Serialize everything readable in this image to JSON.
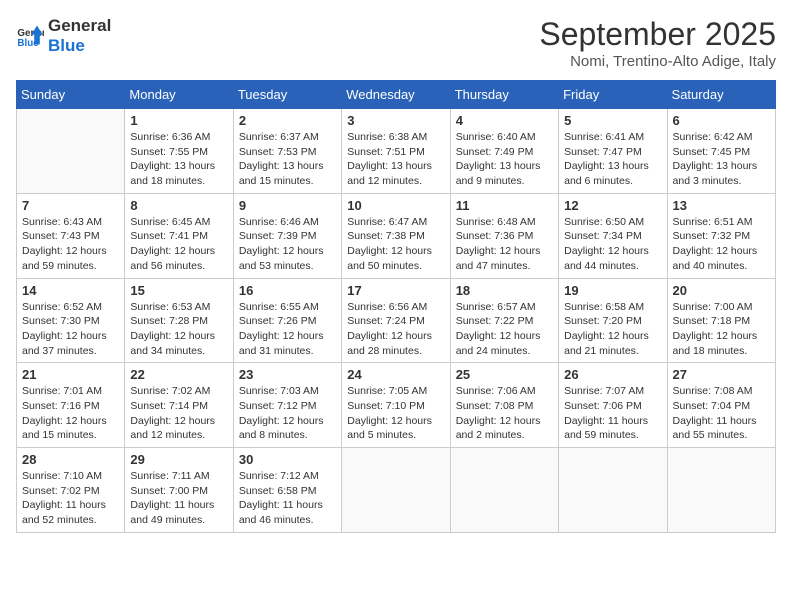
{
  "header": {
    "logo_line1": "General",
    "logo_line2": "Blue",
    "month": "September 2025",
    "location": "Nomi, Trentino-Alto Adige, Italy"
  },
  "days_of_week": [
    "Sunday",
    "Monday",
    "Tuesday",
    "Wednesday",
    "Thursday",
    "Friday",
    "Saturday"
  ],
  "weeks": [
    [
      {
        "day": "",
        "info": ""
      },
      {
        "day": "1",
        "info": "Sunrise: 6:36 AM\nSunset: 7:55 PM\nDaylight: 13 hours\nand 18 minutes."
      },
      {
        "day": "2",
        "info": "Sunrise: 6:37 AM\nSunset: 7:53 PM\nDaylight: 13 hours\nand 15 minutes."
      },
      {
        "day": "3",
        "info": "Sunrise: 6:38 AM\nSunset: 7:51 PM\nDaylight: 13 hours\nand 12 minutes."
      },
      {
        "day": "4",
        "info": "Sunrise: 6:40 AM\nSunset: 7:49 PM\nDaylight: 13 hours\nand 9 minutes."
      },
      {
        "day": "5",
        "info": "Sunrise: 6:41 AM\nSunset: 7:47 PM\nDaylight: 13 hours\nand 6 minutes."
      },
      {
        "day": "6",
        "info": "Sunrise: 6:42 AM\nSunset: 7:45 PM\nDaylight: 13 hours\nand 3 minutes."
      }
    ],
    [
      {
        "day": "7",
        "info": "Sunrise: 6:43 AM\nSunset: 7:43 PM\nDaylight: 12 hours\nand 59 minutes."
      },
      {
        "day": "8",
        "info": "Sunrise: 6:45 AM\nSunset: 7:41 PM\nDaylight: 12 hours\nand 56 minutes."
      },
      {
        "day": "9",
        "info": "Sunrise: 6:46 AM\nSunset: 7:39 PM\nDaylight: 12 hours\nand 53 minutes."
      },
      {
        "day": "10",
        "info": "Sunrise: 6:47 AM\nSunset: 7:38 PM\nDaylight: 12 hours\nand 50 minutes."
      },
      {
        "day": "11",
        "info": "Sunrise: 6:48 AM\nSunset: 7:36 PM\nDaylight: 12 hours\nand 47 minutes."
      },
      {
        "day": "12",
        "info": "Sunrise: 6:50 AM\nSunset: 7:34 PM\nDaylight: 12 hours\nand 44 minutes."
      },
      {
        "day": "13",
        "info": "Sunrise: 6:51 AM\nSunset: 7:32 PM\nDaylight: 12 hours\nand 40 minutes."
      }
    ],
    [
      {
        "day": "14",
        "info": "Sunrise: 6:52 AM\nSunset: 7:30 PM\nDaylight: 12 hours\nand 37 minutes."
      },
      {
        "day": "15",
        "info": "Sunrise: 6:53 AM\nSunset: 7:28 PM\nDaylight: 12 hours\nand 34 minutes."
      },
      {
        "day": "16",
        "info": "Sunrise: 6:55 AM\nSunset: 7:26 PM\nDaylight: 12 hours\nand 31 minutes."
      },
      {
        "day": "17",
        "info": "Sunrise: 6:56 AM\nSunset: 7:24 PM\nDaylight: 12 hours\nand 28 minutes."
      },
      {
        "day": "18",
        "info": "Sunrise: 6:57 AM\nSunset: 7:22 PM\nDaylight: 12 hours\nand 24 minutes."
      },
      {
        "day": "19",
        "info": "Sunrise: 6:58 AM\nSunset: 7:20 PM\nDaylight: 12 hours\nand 21 minutes."
      },
      {
        "day": "20",
        "info": "Sunrise: 7:00 AM\nSunset: 7:18 PM\nDaylight: 12 hours\nand 18 minutes."
      }
    ],
    [
      {
        "day": "21",
        "info": "Sunrise: 7:01 AM\nSunset: 7:16 PM\nDaylight: 12 hours\nand 15 minutes."
      },
      {
        "day": "22",
        "info": "Sunrise: 7:02 AM\nSunset: 7:14 PM\nDaylight: 12 hours\nand 12 minutes."
      },
      {
        "day": "23",
        "info": "Sunrise: 7:03 AM\nSunset: 7:12 PM\nDaylight: 12 hours\nand 8 minutes."
      },
      {
        "day": "24",
        "info": "Sunrise: 7:05 AM\nSunset: 7:10 PM\nDaylight: 12 hours\nand 5 minutes."
      },
      {
        "day": "25",
        "info": "Sunrise: 7:06 AM\nSunset: 7:08 PM\nDaylight: 12 hours\nand 2 minutes."
      },
      {
        "day": "26",
        "info": "Sunrise: 7:07 AM\nSunset: 7:06 PM\nDaylight: 11 hours\nand 59 minutes."
      },
      {
        "day": "27",
        "info": "Sunrise: 7:08 AM\nSunset: 7:04 PM\nDaylight: 11 hours\nand 55 minutes."
      }
    ],
    [
      {
        "day": "28",
        "info": "Sunrise: 7:10 AM\nSunset: 7:02 PM\nDaylight: 11 hours\nand 52 minutes."
      },
      {
        "day": "29",
        "info": "Sunrise: 7:11 AM\nSunset: 7:00 PM\nDaylight: 11 hours\nand 49 minutes."
      },
      {
        "day": "30",
        "info": "Sunrise: 7:12 AM\nSunset: 6:58 PM\nDaylight: 11 hours\nand 46 minutes."
      },
      {
        "day": "",
        "info": ""
      },
      {
        "day": "",
        "info": ""
      },
      {
        "day": "",
        "info": ""
      },
      {
        "day": "",
        "info": ""
      }
    ]
  ]
}
